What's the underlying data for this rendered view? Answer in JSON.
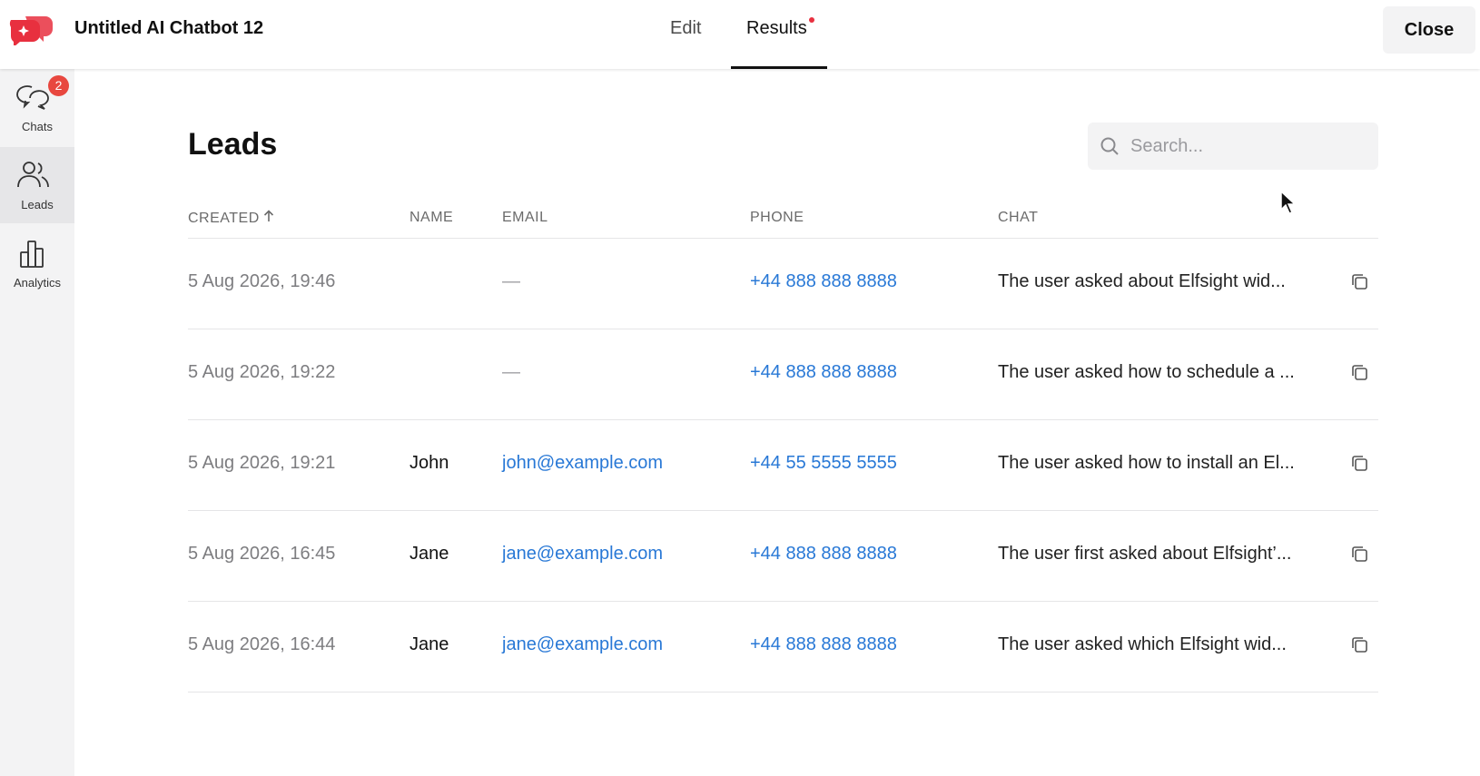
{
  "header": {
    "app_title": "Untitled AI Chatbot 12",
    "tabs": [
      {
        "label": "Edit",
        "active": false
      },
      {
        "label": "Results",
        "active": true,
        "has_notification_dot": true
      }
    ],
    "close_label": "Close"
  },
  "sidebar": {
    "items": [
      {
        "label": "Chats",
        "icon": "chat-bubbles-icon",
        "badge": "2",
        "active": false
      },
      {
        "label": "Leads",
        "icon": "users-icon",
        "active": true
      },
      {
        "label": "Analytics",
        "icon": "bar-chart-icon",
        "active": false
      }
    ]
  },
  "main": {
    "title": "Leads",
    "search": {
      "placeholder": "Search...",
      "value": ""
    },
    "columns": {
      "created": "CREATED",
      "name": "NAME",
      "email": "EMAIL",
      "phone": "PHONE",
      "chat": "CHAT"
    },
    "rows": [
      {
        "created": "5 Aug 2026, 19:46",
        "name": "",
        "email": "—",
        "phone": "+44 888 888 8888",
        "chat": "The user asked about Elfsight wid..."
      },
      {
        "created": "5 Aug 2026, 19:22",
        "name": "",
        "email": "—",
        "phone": "+44 888 888 8888",
        "chat": "The user asked how to schedule a ..."
      },
      {
        "created": "5 Aug 2026, 19:21",
        "name": "John",
        "email": "john@example.com",
        "phone": "+44 55 5555 5555",
        "chat": "The user asked how to install an El..."
      },
      {
        "created": "5 Aug 2026, 16:45",
        "name": "Jane",
        "email": "jane@example.com",
        "phone": "+44 888 888 8888",
        "chat": "The user first asked about Elfsight’..."
      },
      {
        "created": "5 Aug 2026, 16:44",
        "name": "Jane",
        "email": "jane@example.com",
        "phone": "+44 888 888 8888",
        "chat": "The user asked which Elfsight wid..."
      }
    ]
  },
  "colors": {
    "brand": "#e8303f",
    "link": "#2878d6",
    "badge": "#e8473f",
    "sidebar_bg": "#f3f3f4"
  }
}
